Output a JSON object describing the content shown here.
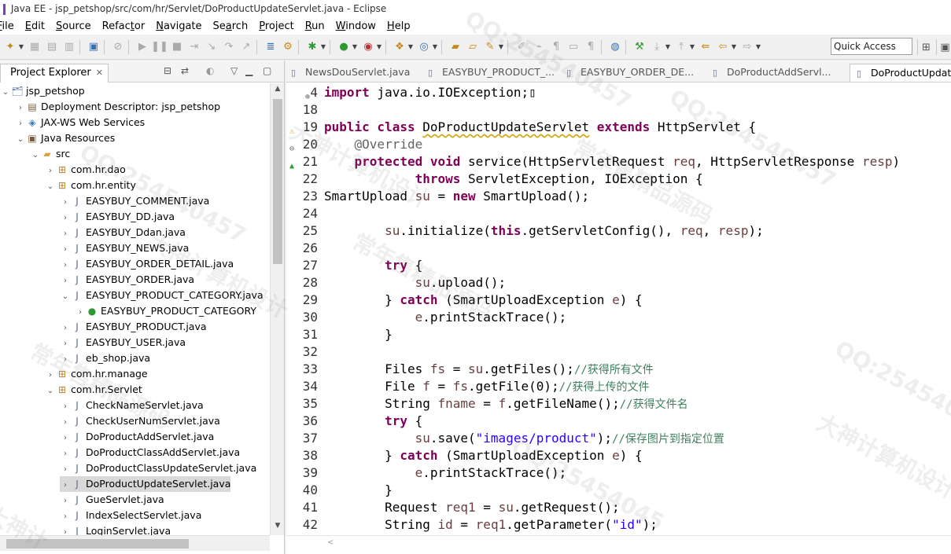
{
  "window": {
    "title": "Java EE - jsp_petshop/src/com/hr/Servlet/DoProductUpdateServlet.java - Eclipse"
  },
  "menu": [
    {
      "mnemonic": "F",
      "rest": "ile"
    },
    {
      "mnemonic": "E",
      "rest": "dit"
    },
    {
      "mnemonic": "S",
      "rest": "ource"
    },
    {
      "mnemonic": "",
      "rest": "Refac",
      "mnemonic2": "t",
      "rest2": "or"
    },
    {
      "mnemonic": "N",
      "rest": "avigate"
    },
    {
      "mnemonic": "",
      "rest": "Se",
      "mnemonic2": "a",
      "rest2": "rch"
    },
    {
      "mnemonic": "P",
      "rest": "roject"
    },
    {
      "mnemonic": "R",
      "rest": "un"
    },
    {
      "mnemonic": "W",
      "rest": "indow"
    },
    {
      "mnemonic": "H",
      "rest": "elp"
    }
  ],
  "toolbar": {
    "quick_access": "Quick Access"
  },
  "explorer": {
    "title": "Project Explorer",
    "close": "✕",
    "tree": [
      {
        "depth": 0,
        "twisty": "⌄",
        "icon": "project-icon",
        "glyph": "🗂",
        "label": "jsp_petshop"
      },
      {
        "depth": 1,
        "twisty": "›",
        "icon": "deployment-descriptor-icon",
        "glyph": "▤",
        "label": "Deployment Descriptor: jsp_petshop"
      },
      {
        "depth": 1,
        "twisty": "›",
        "icon": "web-services-icon",
        "glyph": "◈",
        "label": "JAX-WS Web Services"
      },
      {
        "depth": 1,
        "twisty": "⌄",
        "icon": "java-resources-icon",
        "glyph": "▣",
        "label": "Java Resources"
      },
      {
        "depth": 2,
        "twisty": "⌄",
        "icon": "source-folder-icon",
        "glyph": "▰",
        "label": "src"
      },
      {
        "depth": 3,
        "twisty": "›",
        "icon": "package-icon",
        "glyph": "⊞",
        "label": "com.hr.dao"
      },
      {
        "depth": 3,
        "twisty": "⌄",
        "icon": "package-icon",
        "glyph": "⊞",
        "label": "com.hr.entity"
      },
      {
        "depth": 4,
        "twisty": "›",
        "icon": "java-file-icon",
        "glyph": "J",
        "label": "EASYBUY_COMMENT.java"
      },
      {
        "depth": 4,
        "twisty": "›",
        "icon": "java-file-icon",
        "glyph": "J",
        "label": "EASYBUY_DD.java"
      },
      {
        "depth": 4,
        "twisty": "›",
        "icon": "java-file-icon",
        "glyph": "J",
        "label": "EASYBUY_Ddan.java"
      },
      {
        "depth": 4,
        "twisty": "›",
        "icon": "java-file-icon",
        "glyph": "J",
        "label": "EASYBUY_NEWS.java"
      },
      {
        "depth": 4,
        "twisty": "›",
        "icon": "java-file-icon",
        "glyph": "J",
        "label": "EASYBUY_ORDER_DETAIL.java"
      },
      {
        "depth": 4,
        "twisty": "›",
        "icon": "java-file-icon",
        "glyph": "J",
        "label": "EASYBUY_ORDER.java"
      },
      {
        "depth": 4,
        "twisty": "⌄",
        "icon": "java-file-icon",
        "glyph": "J",
        "label": "EASYBUY_PRODUCT_CATEGORY.java"
      },
      {
        "depth": 5,
        "twisty": "›",
        "icon": "class-icon",
        "glyph": "●",
        "label": "EASYBUY_PRODUCT_CATEGORY"
      },
      {
        "depth": 4,
        "twisty": "›",
        "icon": "java-file-icon",
        "glyph": "J",
        "label": "EASYBUY_PRODUCT.java"
      },
      {
        "depth": 4,
        "twisty": "›",
        "icon": "java-file-icon",
        "glyph": "J",
        "label": "EASYBUY_USER.java"
      },
      {
        "depth": 4,
        "twisty": "›",
        "icon": "java-file-icon",
        "glyph": "J",
        "label": "eb_shop.java"
      },
      {
        "depth": 3,
        "twisty": "›",
        "icon": "package-icon",
        "glyph": "⊞",
        "label": "com.hr.manage"
      },
      {
        "depth": 3,
        "twisty": "⌄",
        "icon": "package-icon",
        "glyph": "⊞",
        "label": "com.hr.Servlet"
      },
      {
        "depth": 4,
        "twisty": "›",
        "icon": "java-file-icon",
        "glyph": "J",
        "label": "CheckNameServlet.java"
      },
      {
        "depth": 4,
        "twisty": "›",
        "icon": "java-file-icon",
        "glyph": "J",
        "label": "CheckUserNumServlet.java"
      },
      {
        "depth": 4,
        "twisty": "›",
        "icon": "java-file-icon",
        "glyph": "J",
        "label": "DoProductAddServlet.java"
      },
      {
        "depth": 4,
        "twisty": "›",
        "icon": "java-file-icon",
        "glyph": "J",
        "label": "DoProductClassAddServlet.java"
      },
      {
        "depth": 4,
        "twisty": "›",
        "icon": "java-file-icon",
        "glyph": "J",
        "label": "DoProductClassUpdateServlet.java"
      },
      {
        "depth": 4,
        "twisty": "›",
        "icon": "java-file-icon",
        "glyph": "J",
        "label": "DoProductUpdateServlet.java",
        "selected": true
      },
      {
        "depth": 4,
        "twisty": "›",
        "icon": "java-file-icon",
        "glyph": "J",
        "label": "GueServlet.java"
      },
      {
        "depth": 4,
        "twisty": "›",
        "icon": "java-file-icon",
        "glyph": "J",
        "label": "IndexSelectServlet.java"
      },
      {
        "depth": 4,
        "twisty": "›",
        "icon": "java-file-icon",
        "glyph": "J",
        "label": "LoginServlet.java"
      }
    ]
  },
  "editor": {
    "tabs": [
      {
        "label": "NewsDouServlet.java"
      },
      {
        "label": "EASYBUY_PRODUCT_..."
      },
      {
        "label": "EASYBUY_ORDER_DE..."
      },
      {
        "label": "DoProductAddServl..."
      },
      {
        "label": "DoProductUpdateServlet.java",
        "active": true
      }
    ],
    "lines": [
      {
        "n": "4",
        "marker": "⊕",
        "html": "<span class=\"kw\">import</span> java.io.IOException;▯"
      },
      {
        "n": "18",
        "html": ""
      },
      {
        "n": "19",
        "marker": "⚠",
        "html": "<span class=\"kw\">public class</span> <span class=\"un\">DoProductUpdateServlet</span> <span class=\"kw\">extends</span> HttpServlet {"
      },
      {
        "n": "20",
        "marker": "⊖",
        "html": "    <span class=\"an\">@Override</span>"
      },
      {
        "n": "21",
        "marker": "▲",
        "html": "    <span class=\"kw\">protected void</span> service(HttpServletRequest <span class=\"pm\">req</span>, HttpServletResponse <span class=\"pm\">resp</span>)"
      },
      {
        "n": "22",
        "html": "            <span class=\"kw\">throws</span> ServletException, IOException {"
      },
      {
        "n": "23",
        "html": "SmartUpload <span class=\"pm\">su</span> = <span class=\"kw\">new</span> SmartUpload();"
      },
      {
        "n": "24",
        "html": ""
      },
      {
        "n": "25",
        "html": "        <span class=\"pm\">su</span>.initialize(<span class=\"kw\">this</span>.getServletConfig(), <span class=\"pm\">req</span>, <span class=\"pm\">resp</span>);"
      },
      {
        "n": "26",
        "html": ""
      },
      {
        "n": "27",
        "html": "        <span class=\"kw\">try</span> {"
      },
      {
        "n": "28",
        "html": "            <span class=\"pm\">su</span>.upload();"
      },
      {
        "n": "29",
        "html": "        } <span class=\"kw\">catch</span> (SmartUploadException <span class=\"pm\">e</span>) {"
      },
      {
        "n": "30",
        "html": "            <span class=\"pm\">e</span>.printStackTrace();"
      },
      {
        "n": "31",
        "html": "        }"
      },
      {
        "n": "32",
        "html": ""
      },
      {
        "n": "33",
        "html": "        Files <span class=\"pm\">fs</span> = <span class=\"pm\">su</span>.getFiles();<span class=\"cm\">//获得所有文件</span>"
      },
      {
        "n": "34",
        "html": "        File <span class=\"pm\">f</span> = <span class=\"pm\">fs</span>.getFile(0);<span class=\"cm\">//获得上传的文件</span>"
      },
      {
        "n": "35",
        "html": "        String <span class=\"pm\">fname</span> = <span class=\"pm\">f</span>.getFileName();<span class=\"cm\">//获得文件名</span>"
      },
      {
        "n": "36",
        "html": "        <span class=\"kw\">try</span> {"
      },
      {
        "n": "37",
        "html": "            <span class=\"pm\">su</span>.save(<span class=\"st\">\"images/product\"</span>);<span class=\"cm\">//保存图片到指定位置</span>"
      },
      {
        "n": "38",
        "html": "        } <span class=\"kw\">catch</span> (SmartUploadException <span class=\"pm\">e</span>) {"
      },
      {
        "n": "39",
        "html": "            <span class=\"pm\">e</span>.printStackTrace();"
      },
      {
        "n": "40",
        "html": "        }"
      },
      {
        "n": "41",
        "html": "        Request <span class=\"pm\">req1</span> = <span class=\"pm\">su</span>.getRequest();"
      },
      {
        "n": "42",
        "html": "        String <span class=\"pm\">id</span> = <span class=\"pm\">req1</span>.getParameter(<span class=\"st\">\"id\"</span>);"
      }
    ]
  },
  "watermarks": [
    "QQ:254540457",
    "大神计算机设计",
    "常年售精品源码",
    "QQ:254540457",
    "大神计算机设计",
    "常年售精品源码",
    "QQ:254540457",
    "大神计算机设计",
    "常年售精品源码",
    "QQ:254540457",
    "大神计",
    "QQ:25454045"
  ]
}
